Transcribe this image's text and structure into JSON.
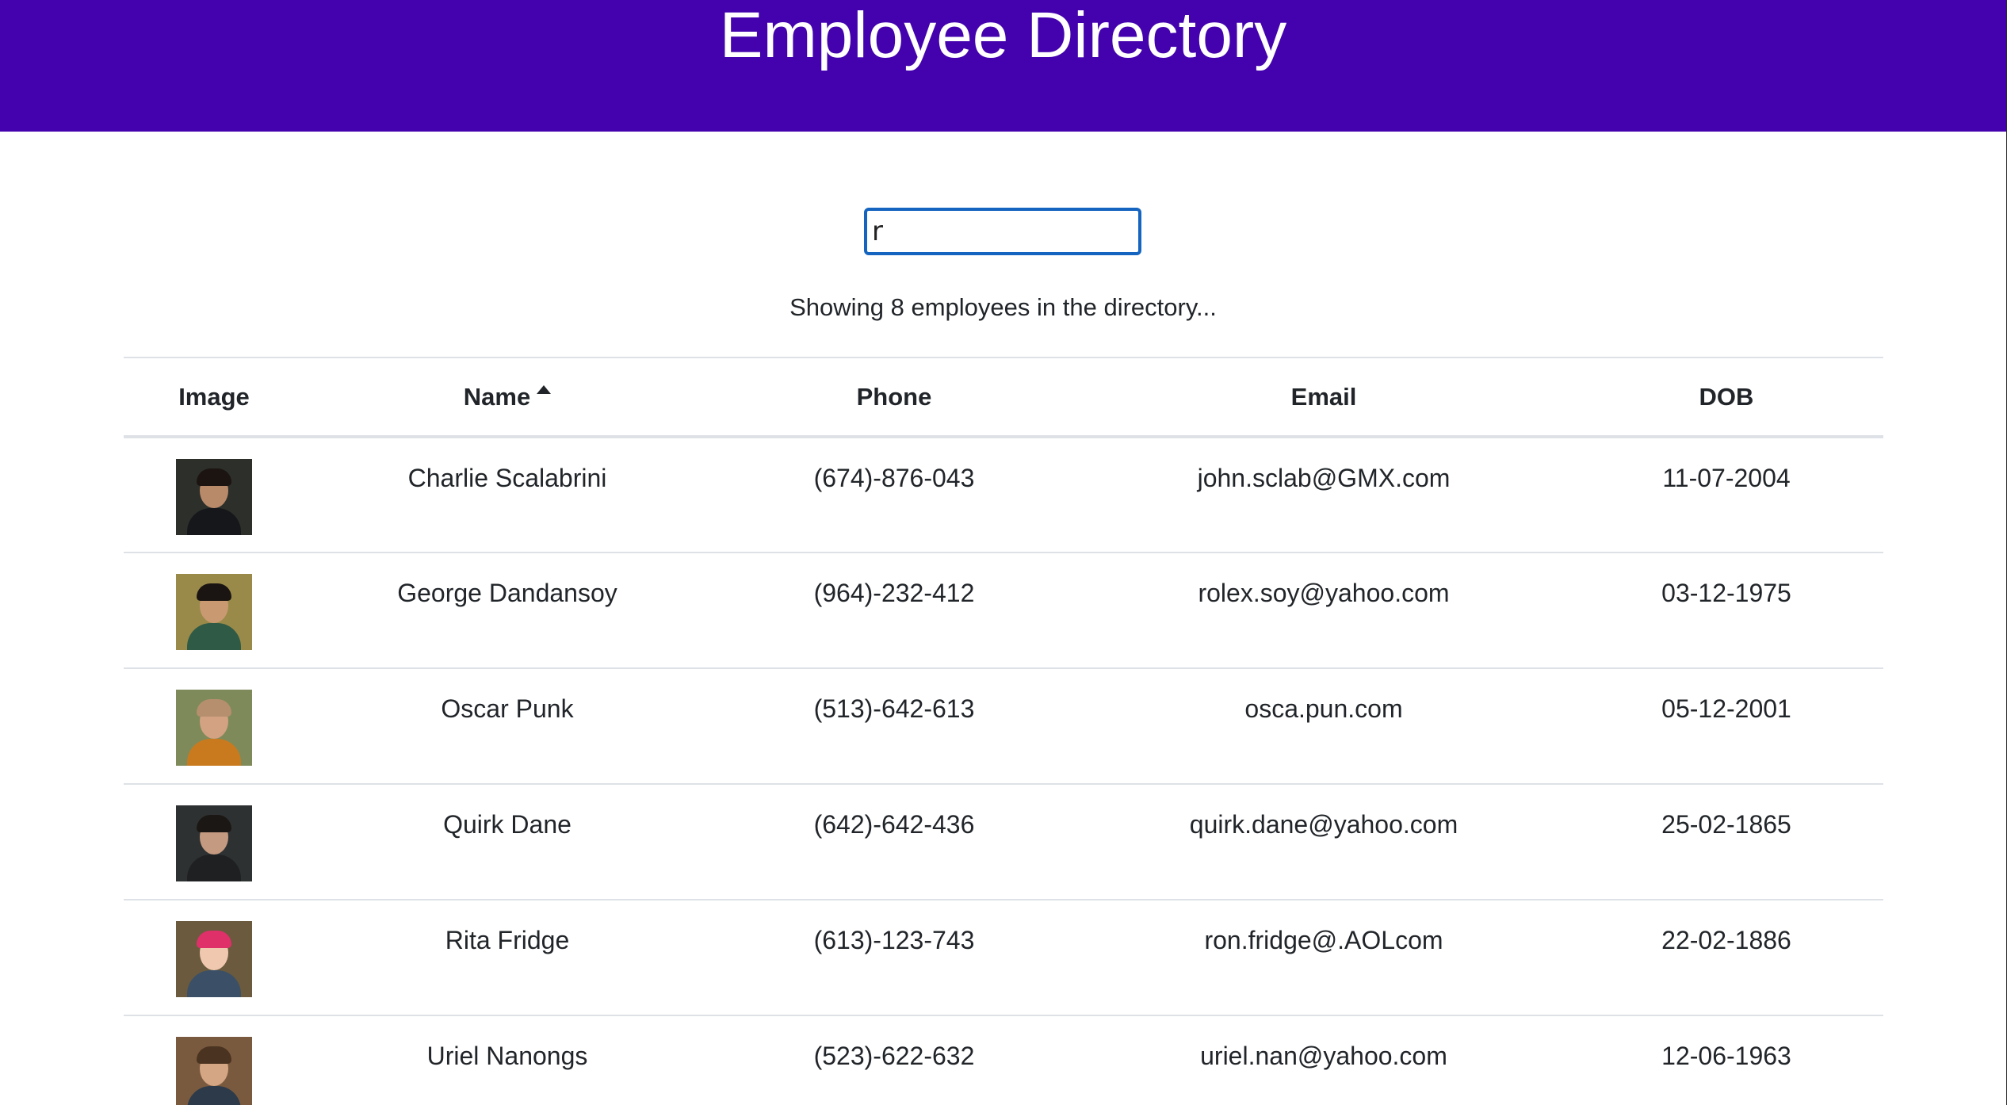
{
  "header": {
    "title": "Employee Directory"
  },
  "search": {
    "value": "r",
    "placeholder": ""
  },
  "status": {
    "text": "Showing 8 employees in the directory..."
  },
  "table": {
    "columns": [
      {
        "label": "Image"
      },
      {
        "label": "Name",
        "sort": "ascending",
        "sort_icon": "caret-up-icon"
      },
      {
        "label": "Phone"
      },
      {
        "label": "Email"
      },
      {
        "label": "DOB"
      }
    ],
    "rows": [
      {
        "name": "Charlie Scalabrini",
        "phone": "(674)-876-043",
        "email": "john.sclab@GMX.com",
        "dob": "11-07-2004",
        "photo": {
          "bg": "#2c2f2a",
          "skin": "#b98a6a",
          "hair": "#1c1410",
          "body": "#15171a"
        }
      },
      {
        "name": "George Dandansoy",
        "phone": "(964)-232-412",
        "email": "rolex.soy@yahoo.com",
        "dob": "03-12-1975",
        "photo": {
          "bg": "#9a8a4a",
          "skin": "#c99a72",
          "hair": "#1a1512",
          "body": "#2f5a45"
        }
      },
      {
        "name": "Oscar Punk",
        "phone": "(513)-642-613",
        "email": "osca.pun.com",
        "dob": "05-12-2001",
        "photo": {
          "bg": "#7f8a5a",
          "skin": "#d2a283",
          "hair": "#b58f6e",
          "body": "#c97a1e"
        }
      },
      {
        "name": "Quirk Dane",
        "phone": "(642)-642-436",
        "email": "quirk.dane@yahoo.com",
        "dob": "25-02-1865",
        "photo": {
          "bg": "#2e3132",
          "skin": "#c49a80",
          "hair": "#1b1714",
          "body": "#1e2022"
        }
      },
      {
        "name": "Rita Fridge",
        "phone": "(613)-123-743",
        "email": "ron.fridge@.AOLcom",
        "dob": "22-02-1886",
        "photo": {
          "bg": "#6b5a3e",
          "skin": "#f0c8b0",
          "hair": "#e0306a",
          "body": "#3b5066"
        }
      },
      {
        "name": "Uriel Nanongs",
        "phone": "(523)-622-632",
        "email": "uriel.nan@yahoo.com",
        "dob": "12-06-1963",
        "photo": {
          "bg": "#7a5a3e",
          "skin": "#d4a684",
          "hair": "#4a3320",
          "body": "#2c3a4a"
        }
      }
    ]
  }
}
